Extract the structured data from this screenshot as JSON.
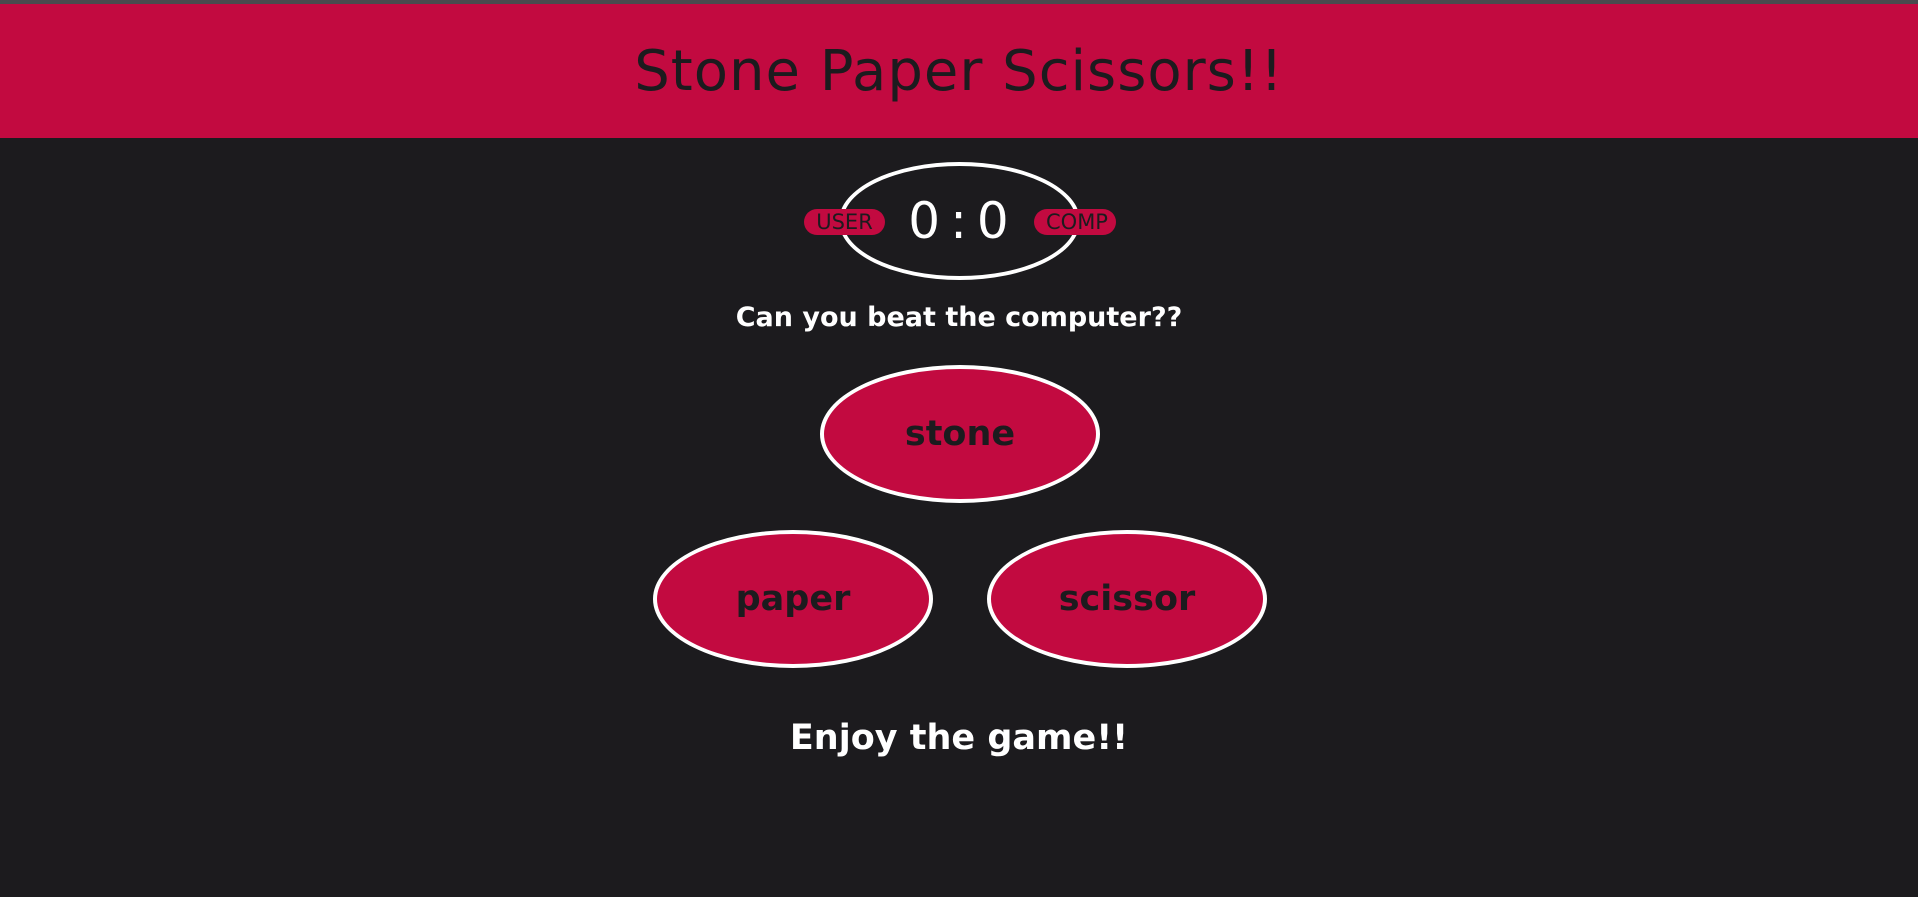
{
  "header": {
    "title": "Stone Paper Scissors!!"
  },
  "scoreboard": {
    "user_label": "USER",
    "comp_label": "COMP",
    "user_score": "0",
    "separator": ":",
    "comp_score": "0"
  },
  "prompt": "Can you beat the computer??",
  "choices": {
    "stone": "stone",
    "paper": "paper",
    "scissor": "scissor"
  },
  "footer": {
    "message": "Enjoy the game!!"
  },
  "colors": {
    "accent": "#c20a40",
    "background": "#1c1b1e",
    "text_light": "#ffffff"
  }
}
